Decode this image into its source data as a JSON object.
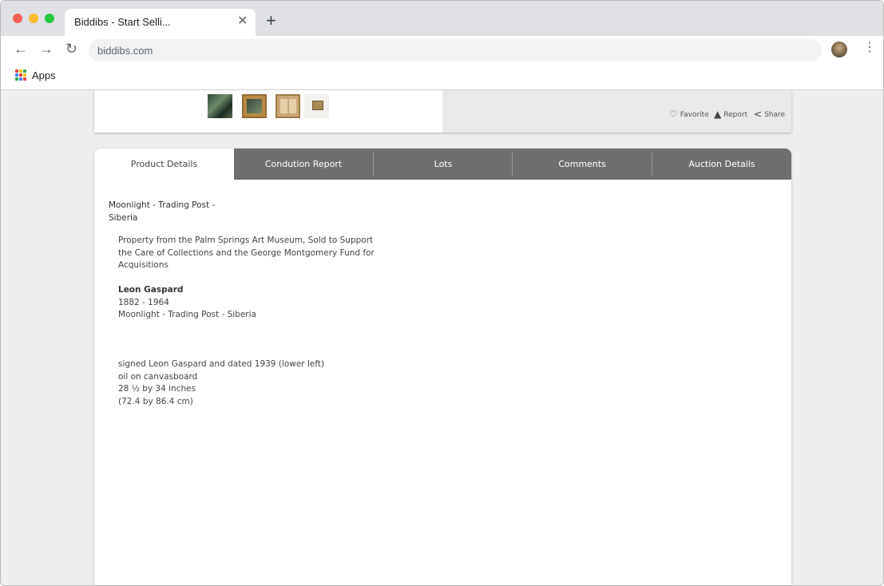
{
  "browser": {
    "tab_title": "Biddibs - Start Selli...",
    "tab_close": "✕",
    "new_tab": "+",
    "back": "←",
    "forward": "→",
    "reload": "↻",
    "url": "biddibs.com",
    "menu": "⋮",
    "bookmarks": {
      "apps_label": "Apps"
    }
  },
  "gallery": {
    "thumbnails": [
      "thumbnail-1",
      "thumbnail-2",
      "thumbnail-3",
      "thumbnail-4"
    ],
    "actions": {
      "favorite": "Favorite",
      "report": "Report",
      "share": "Share"
    },
    "icons": {
      "favorite": "heart-icon",
      "report": "warning-icon",
      "share": "share-icon"
    }
  },
  "details_tabs": [
    {
      "label": "Product Details",
      "active": true
    },
    {
      "label": "Condution Report",
      "active": false
    },
    {
      "label": "Lots",
      "active": false
    },
    {
      "label": "Comments",
      "active": false
    },
    {
      "label": "Auction Details",
      "active": false
    }
  ],
  "product": {
    "title_line1": "Moonlight - Trading Post -",
    "title_line2": "Siberia",
    "provenance_line1": "Property from the Palm Springs Art Museum, Sold to Support",
    "provenance_line2": "the Care of Collections and the George Montgomery Fund for",
    "provenance_line3": "Acquisitions",
    "artist": "Leon Gaspard",
    "artist_dates": "1882 - 1964",
    "work_title": "Moonlight - Trading Post - Siberia",
    "signature": "signed Leon Gaspard and dated 1939 (lower left)",
    "medium": "oil on canvasboard",
    "size_in": "28 ½ by 34 inches",
    "size_cm": "(72.4 by 86.4 cm)"
  },
  "colors": {
    "tabbar": "#6f6f6f",
    "page_bg": "#eeeeee",
    "chrome_tabstrip": "#dfe1e5"
  }
}
